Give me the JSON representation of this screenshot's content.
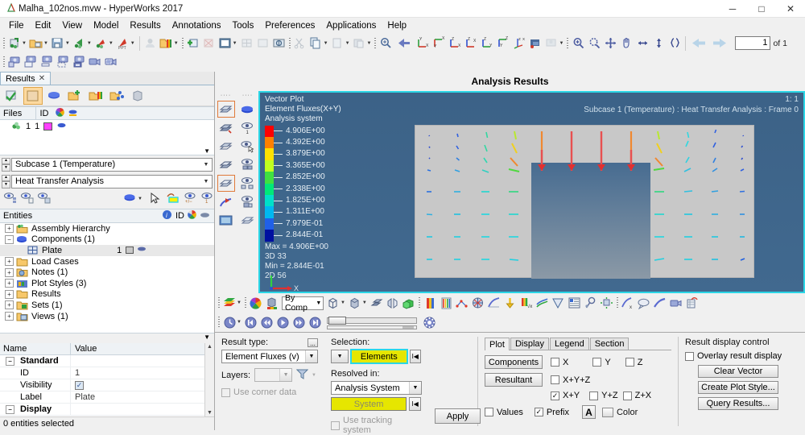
{
  "window": {
    "title": "Malha_102nos.mvw - HyperWorks 2017",
    "app_icon": "hyperworks-icon",
    "minimize": "─",
    "maximize": "□",
    "close": "✕"
  },
  "menubar": {
    "items": [
      "File",
      "Edit",
      "View",
      "Model",
      "Results",
      "Annotations",
      "Tools",
      "Preferences",
      "Applications",
      "Help"
    ]
  },
  "toolbar": {
    "page_value": "1",
    "page_label": "of 1"
  },
  "results_panel": {
    "tab_label": "Results",
    "tab_close": "✕",
    "grid_headers": {
      "files": "Files",
      "id": "ID"
    },
    "file_row": {
      "id": "1",
      "num": "1"
    },
    "subcase_combo": "Subcase 1 (Temperature)",
    "analysis_combo": "Heat Transfer Analysis"
  },
  "entities_panel": {
    "header": "Entities",
    "id_label": "ID",
    "tree": [
      {
        "label": "Assembly Hierarchy",
        "indent": 0,
        "expander": "+",
        "icon": "assembly-icon"
      },
      {
        "label": "Components (1)",
        "indent": 0,
        "expander": "-",
        "icon": "components-icon"
      },
      {
        "label": "Plate",
        "indent": 1,
        "expander": "",
        "icon": "plate-icon",
        "id": "1",
        "selected": true
      },
      {
        "label": "Load Cases",
        "indent": 0,
        "expander": "+",
        "icon": "folder-icon"
      },
      {
        "label": "Notes (1)",
        "indent": 0,
        "expander": "+",
        "icon": "notes-icon"
      },
      {
        "label": "Plot Styles (3)",
        "indent": 0,
        "expander": "+",
        "icon": "plotstyles-icon"
      },
      {
        "label": "Results",
        "indent": 0,
        "expander": "+",
        "icon": "folder-icon"
      },
      {
        "label": "Sets  (1)",
        "indent": 0,
        "expander": "+",
        "icon": "sets-icon"
      },
      {
        "label": "Views (1)",
        "indent": 0,
        "expander": "+",
        "icon": "views-icon"
      }
    ]
  },
  "properties_panel": {
    "col_name": "Name",
    "col_value": "Value",
    "rows": [
      {
        "name": "Standard",
        "value": "",
        "group": true
      },
      {
        "name": "ID",
        "value": "1",
        "group": false
      },
      {
        "name": "Visibility",
        "value": "checkbox",
        "group": false
      },
      {
        "name": "Label",
        "value": "Plate",
        "group": false
      },
      {
        "name": "Display",
        "value": "",
        "group": true
      }
    ]
  },
  "statusbar": {
    "text": "0 entities selected"
  },
  "viewport": {
    "title": "Analysis Results",
    "corner_id": "1: 1",
    "subcase_line": "Subcase 1 (Temperature) : Heat Transfer Analysis : Frame 0",
    "legend": {
      "line1": "Vector Plot",
      "line2": "Element Fluxes(X+Y)",
      "line3": "Analysis system",
      "values": [
        "4.906E+00",
        "4.392E+00",
        "3.879E+00",
        "3.365E+00",
        "2.852E+00",
        "2.338E+00",
        "1.825E+00",
        "1.311E+00",
        "7.979E-01",
        "2.844E-01"
      ],
      "colors": [
        "#ff0000",
        "#ff8000",
        "#ffe000",
        "#bfff20",
        "#40e040",
        "#00e878",
        "#00e0c8",
        "#00b8f0",
        "#2060e8",
        "#0010a0"
      ],
      "max_label": "Max = 4.906E+00",
      "max_count": "3D 33",
      "min_label": "Min = 2.844E-01",
      "min_count": "2D 56",
      "axis_x": "X"
    }
  },
  "anim_toolbar": {
    "by_comp": "By Comp"
  },
  "result_controls": {
    "result_type_label": "Result type:",
    "result_type_value": "Element Fluxes (v)",
    "ellipsis": "...",
    "layers_label": "Layers:",
    "layers_value": "",
    "use_corner_data": "Use corner data",
    "selection_label": "Selection:",
    "elements_button": "Elements",
    "resolved_label": "Resolved in:",
    "resolved_value": "Analysis System",
    "system_button": "System",
    "use_tracking": "Use tracking system",
    "apply_button": "Apply"
  },
  "plot_tabs": {
    "tabs": [
      "Plot",
      "Display",
      "Legend",
      "Section"
    ],
    "active": "Plot",
    "components_button": "Components",
    "resultant_button": "Resultant",
    "comp_checks": [
      {
        "label": "X",
        "checked": false
      },
      {
        "label": "Y",
        "checked": false
      },
      {
        "label": "Z",
        "checked": false
      }
    ],
    "res_checks_row1": [
      {
        "label": "X+Y+Z",
        "checked": false
      }
    ],
    "res_checks_row2": [
      {
        "label": "X+Y",
        "checked": true
      },
      {
        "label": "Y+Z",
        "checked": false
      },
      {
        "label": "Z+X",
        "checked": false
      }
    ],
    "values_check": {
      "label": "Values",
      "checked": false
    },
    "prefix_check": {
      "label": "Prefix",
      "checked": true
    },
    "font_button": "A",
    "color_label": "Color"
  },
  "display_control": {
    "title": "Result display control",
    "overlay_check": {
      "label": "Overlay result display",
      "checked": false
    },
    "buttons": [
      "Clear Vector",
      "Create Plot Style...",
      "Query Results..."
    ]
  },
  "colors": {
    "accent_cyan": "#2bd6e6",
    "viewport_bg": "#3c6287",
    "model_gray": "#c8c8c8",
    "yellow_button": "#e6e600",
    "selection_orange": "#fcd9a0"
  }
}
